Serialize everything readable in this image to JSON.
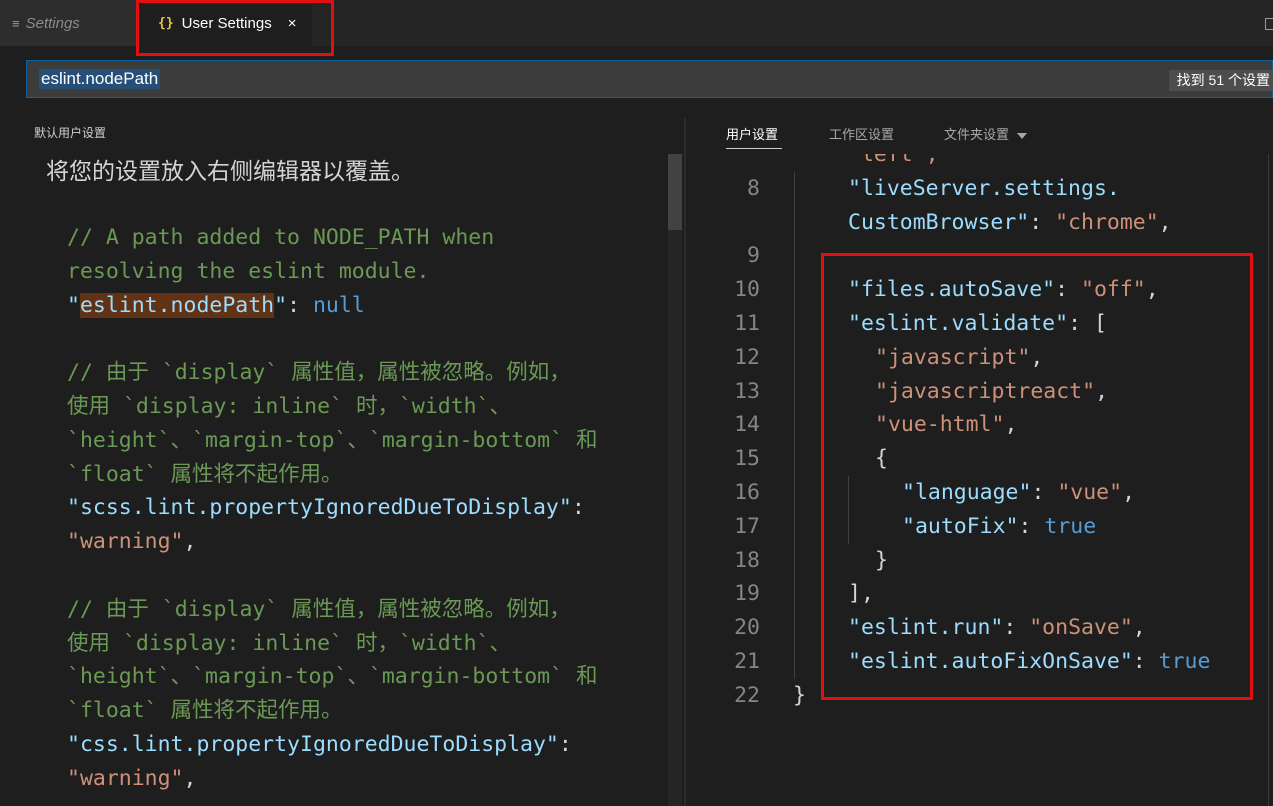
{
  "tabs": {
    "settings": {
      "icon": "list-icon",
      "label": "Settings"
    },
    "user_settings": {
      "icon": "braces-icon",
      "icon_glyph": "{}",
      "label": "User Settings",
      "close_glyph": "×"
    }
  },
  "search": {
    "value": "eslint.nodePath",
    "result_count": "找到 51 个设置"
  },
  "left_pane": {
    "header": "默认用户设置",
    "intro": "将您的设置放入右侧编辑器以覆盖。",
    "lines": [
      [
        {
          "t": "// A path added to NODE_PATH when",
          "c": "cm"
        }
      ],
      [
        {
          "t": "resolving the eslint module.",
          "c": "cm"
        }
      ],
      [
        {
          "t": "\"",
          "c": "ky"
        },
        {
          "t": "eslint.nodePath",
          "c": "ky hl"
        },
        {
          "t": "\"",
          "c": "ky"
        },
        {
          "t": ": ",
          "c": "pn"
        },
        {
          "t": "null",
          "c": "kw"
        }
      ],
      [
        {
          "t": "",
          "c": "pn"
        }
      ],
      [
        {
          "t": "// 由于 `display` 属性值，属性被忽略。例如，",
          "c": "cm"
        }
      ],
      [
        {
          "t": "使用 `display: inline` 时，`width`、",
          "c": "cm"
        }
      ],
      [
        {
          "t": "`height`、`margin-top`、`margin-bottom` 和",
          "c": "cm"
        }
      ],
      [
        {
          "t": "`float` 属性将不起作用。",
          "c": "cm"
        }
      ],
      [
        {
          "t": "\"scss.lint.propertyIgnoredDueToDisplay\"",
          "c": "ky"
        },
        {
          "t": ":",
          "c": "pn"
        }
      ],
      [
        {
          "t": "\"warning\"",
          "c": "st"
        },
        {
          "t": ",",
          "c": "pn"
        }
      ],
      [
        {
          "t": "",
          "c": "pn"
        }
      ],
      [
        {
          "t": "// 由于 `display` 属性值，属性被忽略。例如，",
          "c": "cm"
        }
      ],
      [
        {
          "t": "使用 `display: inline` 时，`width`、",
          "c": "cm"
        }
      ],
      [
        {
          "t": "`height`、`margin-top`、`margin-bottom` 和",
          "c": "cm"
        }
      ],
      [
        {
          "t": "`float` 属性将不起作用。",
          "c": "cm"
        }
      ],
      [
        {
          "t": "\"css.lint.propertyIgnoredDueToDisplay\"",
          "c": "ky"
        },
        {
          "t": ":",
          "c": "pn"
        }
      ],
      [
        {
          "t": "\"warning\"",
          "c": "st"
        },
        {
          "t": ",",
          "c": "pn"
        }
      ]
    ]
  },
  "right_pane": {
    "tabs": [
      "用户设置",
      "工作区设置",
      "文件夹设置"
    ],
    "active_tab": "用户设置",
    "lines": [
      {
        "n": "",
        "indent": 0,
        "tokens": [
          {
            "t": "\"left\",",
            "c": "st"
          }
        ]
      },
      {
        "n": "8",
        "indent": 1,
        "tokens": [
          {
            "t": "\"liveServer.settings.",
            "c": "ky"
          }
        ]
      },
      {
        "n": "",
        "indent": 1,
        "tokens": [
          {
            "t": "CustomBrowser\"",
            "c": "ky"
          },
          {
            "t": ": ",
            "c": "pn"
          },
          {
            "t": "\"chrome\"",
            "c": "st"
          },
          {
            "t": ",",
            "c": "pn"
          }
        ]
      },
      {
        "n": "9",
        "indent": 1,
        "tokens": []
      },
      {
        "n": "10",
        "indent": 1,
        "tokens": [
          {
            "t": "\"files.autoSave\"",
            "c": "ky"
          },
          {
            "t": ": ",
            "c": "pn"
          },
          {
            "t": "\"off\"",
            "c": "st"
          },
          {
            "t": ",",
            "c": "pn"
          }
        ]
      },
      {
        "n": "11",
        "indent": 1,
        "tokens": [
          {
            "t": "\"eslint.validate\"",
            "c": "ky"
          },
          {
            "t": ": [",
            "c": "pn"
          }
        ]
      },
      {
        "n": "12",
        "indent": 2,
        "tokens": [
          {
            "t": "\"javascript\"",
            "c": "st"
          },
          {
            "t": ",",
            "c": "pn"
          }
        ]
      },
      {
        "n": "13",
        "indent": 2,
        "tokens": [
          {
            "t": "\"javascriptreact\"",
            "c": "st"
          },
          {
            "t": ",",
            "c": "pn"
          }
        ]
      },
      {
        "n": "14",
        "indent": 2,
        "tokens": [
          {
            "t": "\"vue-html\"",
            "c": "st"
          },
          {
            "t": ",",
            "c": "pn"
          }
        ]
      },
      {
        "n": "15",
        "indent": 2,
        "tokens": [
          {
            "t": "{",
            "c": "pn"
          }
        ]
      },
      {
        "n": "16",
        "indent": 3,
        "tokens": [
          {
            "t": "\"language\"",
            "c": "ky"
          },
          {
            "t": ": ",
            "c": "pn"
          },
          {
            "t": "\"vue\"",
            "c": "st"
          },
          {
            "t": ",",
            "c": "pn"
          }
        ]
      },
      {
        "n": "17",
        "indent": 3,
        "tokens": [
          {
            "t": "\"autoFix\"",
            "c": "ky"
          },
          {
            "t": ": ",
            "c": "pn"
          },
          {
            "t": "true",
            "c": "kw"
          }
        ]
      },
      {
        "n": "18",
        "indent": 2,
        "tokens": [
          {
            "t": "}",
            "c": "pn"
          }
        ]
      },
      {
        "n": "19",
        "indent": 1,
        "tokens": [
          {
            "t": "],",
            "c": "pn"
          }
        ]
      },
      {
        "n": "20",
        "indent": 1,
        "tokens": [
          {
            "t": "\"eslint.run\"",
            "c": "ky"
          },
          {
            "t": ": ",
            "c": "pn"
          },
          {
            "t": "\"onSave\"",
            "c": "st"
          },
          {
            "t": ",",
            "c": "pn"
          }
        ]
      },
      {
        "n": "21",
        "indent": 1,
        "tokens": [
          {
            "t": "\"eslint.autoFixOnSave\"",
            "c": "ky"
          },
          {
            "t": ": ",
            "c": "pn"
          },
          {
            "t": "true",
            "c": "kw"
          }
        ]
      },
      {
        "n": "22",
        "indent": 0,
        "tokens": [
          {
            "t": "}",
            "c": "pn"
          }
        ]
      }
    ]
  },
  "colors": {
    "accent": "#0e639c",
    "annotation": "#e01010",
    "key": "#9cdcfe",
    "string": "#ce9178",
    "keyword": "#569cd6",
    "comment": "#6a9955"
  }
}
